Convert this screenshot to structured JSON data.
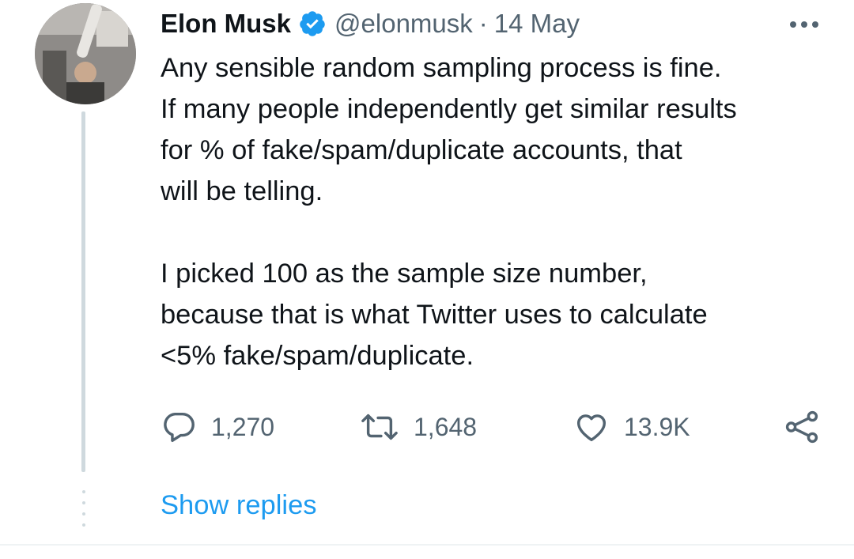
{
  "tweet": {
    "author_name": "Elon Musk",
    "handle": "@elonmusk",
    "separator": "·",
    "date": "14 May",
    "verified": true,
    "paragraphs": [
      [
        "Any sensible random sampling process is fine.",
        "If many people independently get similar results",
        "for % of fake/spam/duplicate accounts, that",
        "will be telling."
      ],
      [
        "I picked 100 as the sample size number,",
        "because that is what Twitter uses to calculate",
        "<5% fake/spam/duplicate."
      ]
    ]
  },
  "actions": {
    "replies": "1,270",
    "retweets": "1,648",
    "likes": "13.9K"
  },
  "show_replies_label": "Show replies",
  "colors": {
    "accent": "#1d9bf0",
    "secondary_text": "#536471",
    "primary_text": "#0f1419",
    "thread_line": "#cfd9de"
  },
  "icons": [
    "verified-badge-icon",
    "more-icon",
    "reply-icon",
    "retweet-icon",
    "like-icon",
    "share-icon"
  ]
}
